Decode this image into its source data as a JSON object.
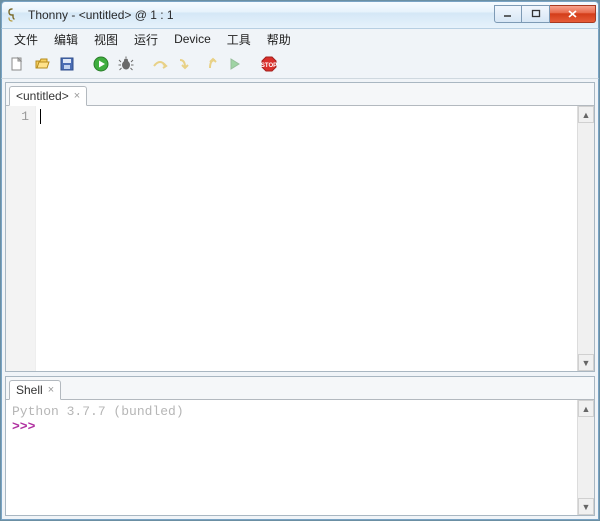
{
  "window": {
    "title": "Thonny  -  <untitled>  @  1 : 1"
  },
  "menu": {
    "file": "文件",
    "edit": "编辑",
    "view": "视图",
    "run": "运行",
    "device": "Device",
    "tools": "工具",
    "help": "帮助"
  },
  "toolbar": {
    "new": "new-file",
    "open": "open-file",
    "save": "save-file",
    "run": "run",
    "debug": "debug",
    "step_over": "step-over",
    "step_into": "step-into",
    "step_out": "step-out",
    "resume": "resume",
    "stop": "stop"
  },
  "editor": {
    "tab_label": "<untitled>",
    "line_numbers": [
      "1"
    ],
    "content": ""
  },
  "shell": {
    "tab_label": "Shell",
    "banner": "Python 3.7.7 (bundled)",
    "prompt": ">>>"
  }
}
